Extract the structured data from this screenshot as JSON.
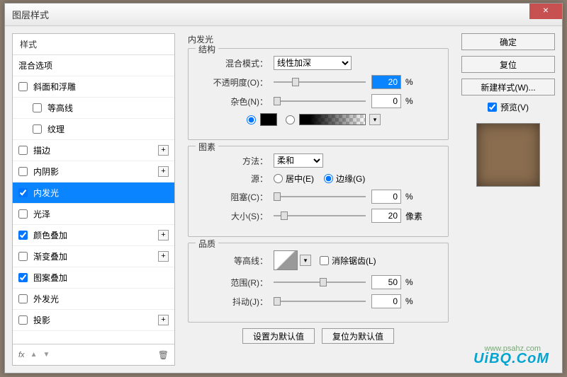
{
  "title": "图层样式",
  "close_label": "×",
  "sidebar": {
    "header": "样式",
    "items": [
      {
        "label": "混合选项",
        "checkbox": false,
        "checked": false,
        "indent": false,
        "plus": false
      },
      {
        "label": "斜面和浮雕",
        "checkbox": true,
        "checked": false,
        "indent": false,
        "plus": false
      },
      {
        "label": "等高线",
        "checkbox": true,
        "checked": false,
        "indent": true,
        "plus": false
      },
      {
        "label": "纹理",
        "checkbox": true,
        "checked": false,
        "indent": true,
        "plus": false
      },
      {
        "label": "描边",
        "checkbox": true,
        "checked": false,
        "indent": false,
        "plus": true
      },
      {
        "label": "内阴影",
        "checkbox": true,
        "checked": false,
        "indent": false,
        "plus": true
      },
      {
        "label": "内发光",
        "checkbox": true,
        "checked": true,
        "indent": false,
        "plus": false,
        "selected": true
      },
      {
        "label": "光泽",
        "checkbox": true,
        "checked": false,
        "indent": false,
        "plus": false
      },
      {
        "label": "颜色叠加",
        "checkbox": true,
        "checked": true,
        "indent": false,
        "plus": true
      },
      {
        "label": "渐变叠加",
        "checkbox": true,
        "checked": false,
        "indent": false,
        "plus": true
      },
      {
        "label": "图案叠加",
        "checkbox": true,
        "checked": true,
        "indent": false,
        "plus": false
      },
      {
        "label": "外发光",
        "checkbox": true,
        "checked": false,
        "indent": false,
        "plus": false
      },
      {
        "label": "投影",
        "checkbox": true,
        "checked": false,
        "indent": false,
        "plus": true
      }
    ],
    "fx": "fx"
  },
  "center": {
    "title": "内发光",
    "structure": {
      "title": "结构",
      "blend_mode_label": "混合模式：",
      "blend_mode_value": "线性加深",
      "opacity_label": "不透明度(O)：",
      "opacity_value": "20",
      "opacity_unit": "%",
      "noise_label": "杂色(N)：",
      "noise_value": "0",
      "noise_unit": "%",
      "color_black": "#000000"
    },
    "elements": {
      "title": "图素",
      "technique_label": "方法：",
      "technique_value": "柔和",
      "source_label": "源：",
      "source_center": "居中(E)",
      "source_edge": "边缘(G)",
      "choke_label": "阻塞(C)：",
      "choke_value": "0",
      "choke_unit": "%",
      "size_label": "大小(S)：",
      "size_value": "20",
      "size_unit": "像素"
    },
    "quality": {
      "title": "品质",
      "contour_label": "等高线：",
      "antialias_label": "消除锯齿(L)",
      "range_label": "范围(R)：",
      "range_value": "50",
      "range_unit": "%",
      "jitter_label": "抖动(J)：",
      "jitter_value": "0",
      "jitter_unit": "%"
    },
    "default_btn": "设置为默认值",
    "reset_btn": "复位为默认值"
  },
  "right": {
    "ok": "确定",
    "reset": "复位",
    "new_style": "新建样式(W)...",
    "preview": "预览(V)"
  },
  "watermark": "UiBQ.CoM",
  "watermark2": "www.psahz.com"
}
